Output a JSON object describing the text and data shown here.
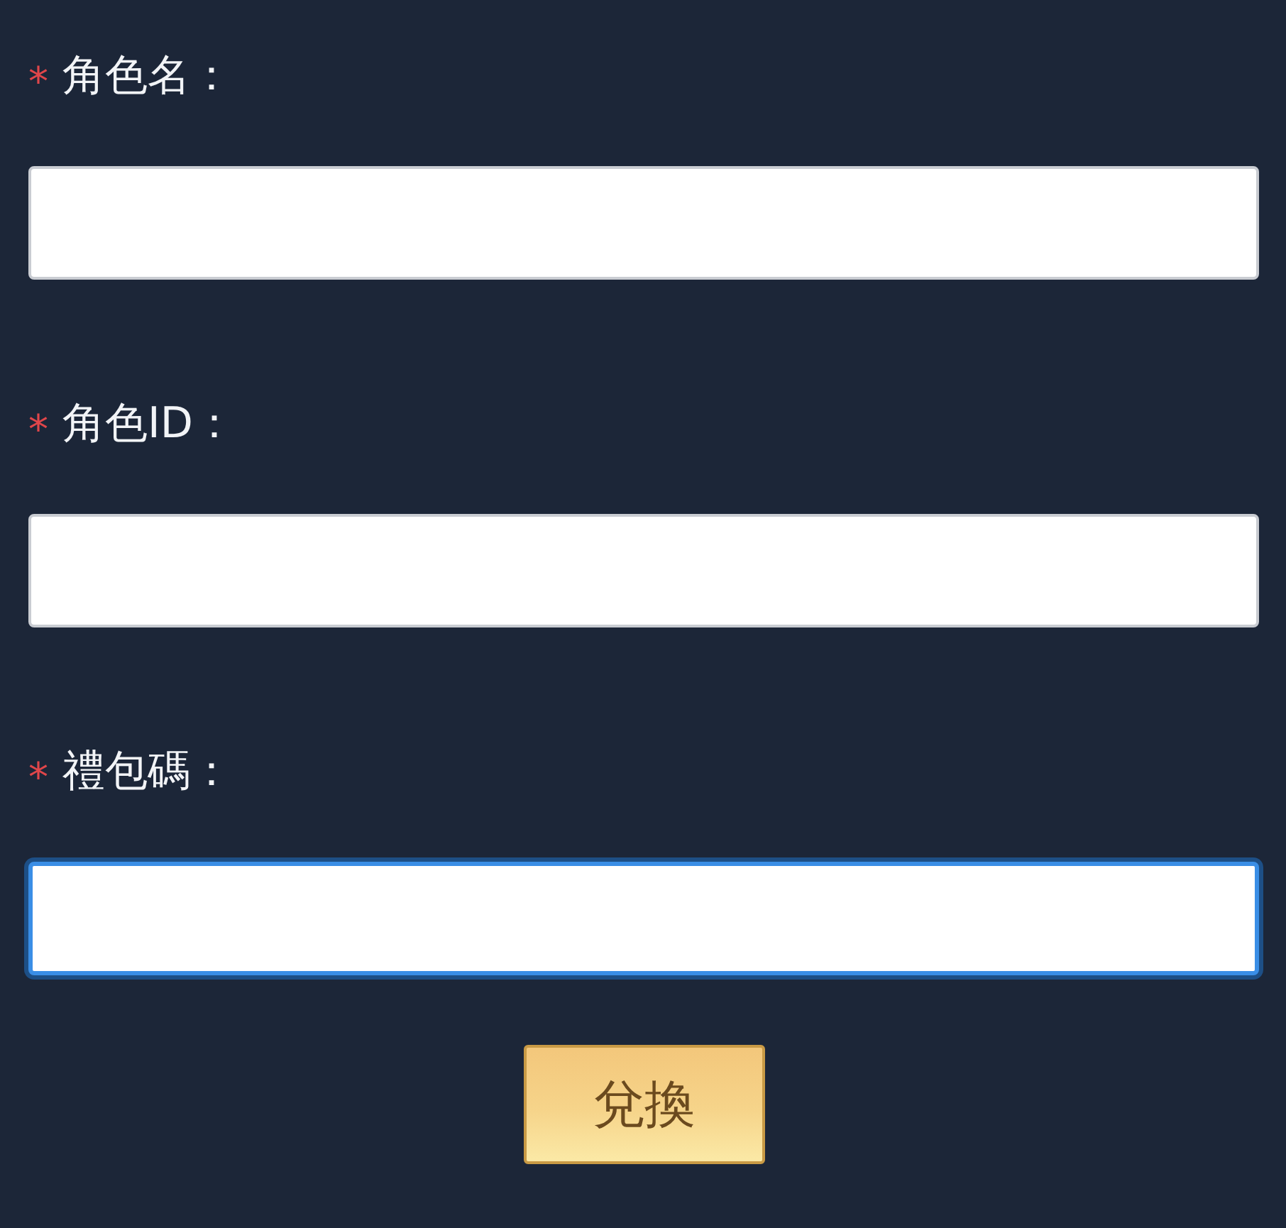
{
  "fields": [
    {
      "required_mark": "*",
      "label": "角色名：",
      "focused": false
    },
    {
      "required_mark": "*",
      "label": "角色ID：",
      "focused": false
    },
    {
      "required_mark": "*",
      "label": "禮包碼：",
      "focused": true
    }
  ],
  "submit_button": {
    "label": "兌換"
  }
}
